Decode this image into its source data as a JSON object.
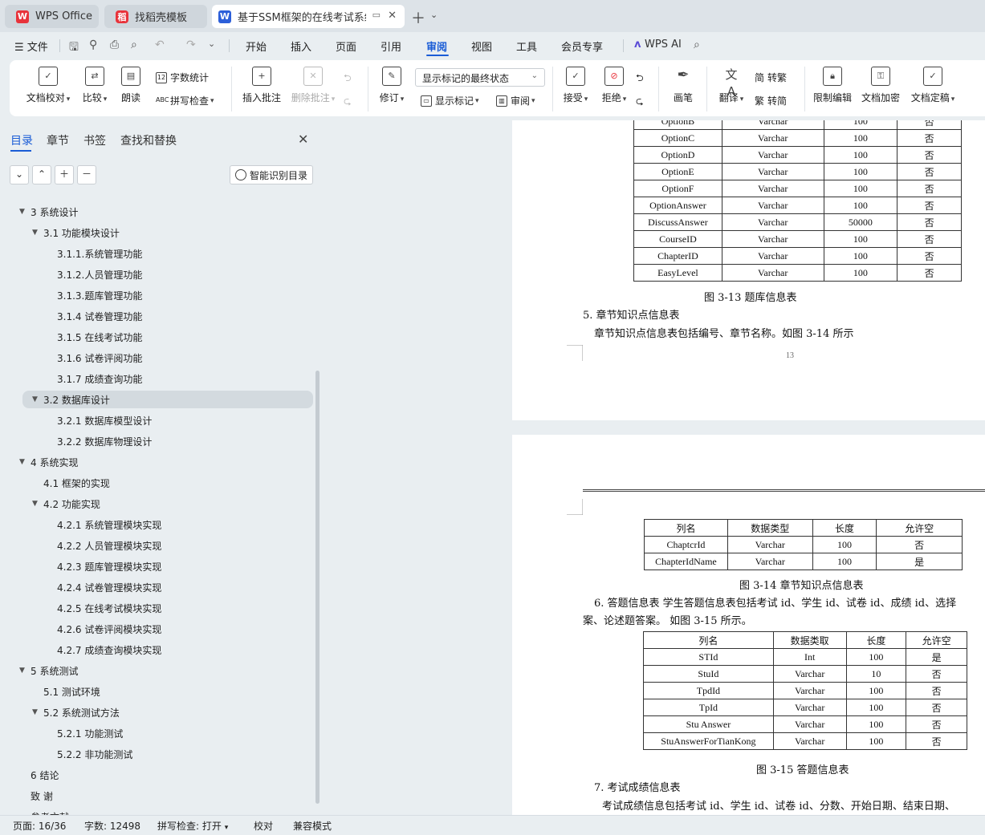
{
  "tabs": [
    {
      "label": "WPS Office",
      "logo": "W"
    },
    {
      "label": "找稻壳模板",
      "logo": "稻"
    },
    {
      "label": "基于SSM框架的在线考试系统",
      "logo": "W"
    }
  ],
  "menu": {
    "file": "文件",
    "items": [
      "开始",
      "插入",
      "页面",
      "引用",
      "审阅",
      "视图",
      "工具",
      "会员专享"
    ],
    "active": "审阅",
    "wps_ai": "WPS AI"
  },
  "ribbon": {
    "doc_check": "文档校对",
    "compare": "比较",
    "read_aloud": "朗读",
    "word_count": "字数统计",
    "spell_check": "拼写检查",
    "insert_comment": "插入批注",
    "delete_comment": "删除批注",
    "revise": "修订",
    "markup_state": "显示标记的最终状态",
    "show_markup": "显示标记",
    "review": "审阅",
    "accept": "接受",
    "reject": "拒绝",
    "pen": "画笔",
    "translate": "翻译",
    "to_traditional": "转繁",
    "to_simplified": "转简",
    "restrict_edit": "限制编辑",
    "doc_encrypt": "文档加密",
    "doc_finalize": "文档定稿"
  },
  "nav": {
    "tabs": [
      "目录",
      "章节",
      "书签",
      "查找和替换"
    ],
    "smart_toc": "智能识别目录",
    "items": [
      {
        "label": "3  系统设计",
        "level": 1,
        "toggle": "▼"
      },
      {
        "label": "3.1  功能模块设计",
        "level": 2,
        "toggle": "▼"
      },
      {
        "label": "3.1.1.系统管理功能",
        "level": 3,
        "toggle": ""
      },
      {
        "label": "3.1.2.人员管理功能",
        "level": 3,
        "toggle": ""
      },
      {
        "label": "3.1.3.题库管理功能",
        "level": 3,
        "toggle": ""
      },
      {
        "label": "3.1.4 试卷管理功能",
        "level": 3,
        "toggle": ""
      },
      {
        "label": "3.1.5 在线考试功能",
        "level": 3,
        "toggle": ""
      },
      {
        "label": "3.1.6 试卷评阅功能",
        "level": 3,
        "toggle": ""
      },
      {
        "label": "3.1.7 成绩查询功能",
        "level": 3,
        "toggle": ""
      },
      {
        "label": "3.2  数据库设计",
        "level": 2,
        "toggle": "▼",
        "selected": true
      },
      {
        "label": "3.2.1  数据库模型设计",
        "level": 3,
        "toggle": ""
      },
      {
        "label": "3.2.2  数据库物理设计",
        "level": 3,
        "toggle": ""
      },
      {
        "label": "4  系统实现",
        "level": 1,
        "toggle": "▼"
      },
      {
        "label": "4.1  框架的实现",
        "level": 2,
        "toggle": ""
      },
      {
        "label": "4.2  功能实现",
        "level": 2,
        "toggle": "▼"
      },
      {
        "label": "4.2.1 系统管理模块实现",
        "level": 3,
        "toggle": ""
      },
      {
        "label": "4.2.2 人员管理模块实现",
        "level": 3,
        "toggle": ""
      },
      {
        "label": "4.2.3 题库管理模块实现",
        "level": 3,
        "toggle": ""
      },
      {
        "label": "4.2.4 试卷管理模块实现",
        "level": 3,
        "toggle": ""
      },
      {
        "label": "4.2.5 在线考试模块实现",
        "level": 3,
        "toggle": ""
      },
      {
        "label": "4.2.6 试卷评阅模块实现",
        "level": 3,
        "toggle": ""
      },
      {
        "label": "4.2.7 成绩查询模块实现",
        "level": 3,
        "toggle": ""
      },
      {
        "label": "5  系统测试",
        "level": 1,
        "toggle": "▼"
      },
      {
        "label": "5.1  测试环境",
        "level": 2,
        "toggle": ""
      },
      {
        "label": "5.2  系统测试方法",
        "level": 2,
        "toggle": "▼"
      },
      {
        "label": "5.2.1 功能测试",
        "level": 3,
        "toggle": ""
      },
      {
        "label": "5.2.2 非功能测试",
        "level": 3,
        "toggle": ""
      },
      {
        "label": "6  结论",
        "level": 1,
        "toggle": ""
      },
      {
        "label": "致     谢",
        "level": 1,
        "toggle": ""
      },
      {
        "label": "参考文献",
        "level": 1,
        "toggle": ""
      }
    ]
  },
  "doc": {
    "table13_rows": [
      [
        "OptionB",
        "Varchar",
        "100",
        "否"
      ],
      [
        "OptionC",
        "Varchar",
        "100",
        "否"
      ],
      [
        "OptionD",
        "Varchar",
        "100",
        "否"
      ],
      [
        "OptionE",
        "Varchar",
        "100",
        "否"
      ],
      [
        "OptionF",
        "Varchar",
        "100",
        "否"
      ],
      [
        "OptionAnswer",
        "Varchar",
        "100",
        "否"
      ],
      [
        "DiscussAnswer",
        "Varchar",
        "50000",
        "否"
      ],
      [
        "CourseID",
        "Varchar",
        "100",
        "否"
      ],
      [
        "ChapterID",
        "Varchar",
        "100",
        "否"
      ],
      [
        "EasyLevel",
        "Varchar",
        "100",
        "否"
      ]
    ],
    "caption13": "图 3-13  题库信息表",
    "heading5": "5.  章节知识点信息表",
    "para5": "章节知识点信息表包括编号、章节名称。如图 3-14  所示",
    "page_number": "13",
    "table14_header": [
      "列名",
      "数据类型",
      "长度",
      "允许空"
    ],
    "table14_rows": [
      [
        "ChaptcrId",
        "Varchar",
        "100",
        "否"
      ],
      [
        "ChapterIdName",
        "Varchar",
        "100",
        "是"
      ]
    ],
    "caption14": "图 3-14 章节知识点信息表",
    "para6_line1": "6.  答题信息表  学生答题信息表包括考试 id、学生 id、试卷 id、成绩 id、选择",
    "para6_line2": "案、论述题答案。  如图 3-15 所示。",
    "table15_header": [
      "列名",
      "数据类取",
      "长度",
      "允许空"
    ],
    "table15_rows": [
      [
        "STId",
        "Int",
        "100",
        "是"
      ],
      [
        "StuId",
        "Varchar",
        "10",
        "否"
      ],
      [
        "TpdId",
        "Varchar",
        "100",
        "否"
      ],
      [
        "TpId",
        "Varchar",
        "100",
        "否"
      ],
      [
        "Stu Answer",
        "Varchar",
        "100",
        "否"
      ],
      [
        "StuAnswerForTianKong",
        "Varchar",
        "100",
        "否"
      ]
    ],
    "caption15": "图 3-15 答题信息表",
    "heading7": "7.  考试成绩信息表",
    "para7": "考试成绩信息包括考试 id、学生 id、试卷 id、分数、开始日期、结束日期、"
  },
  "status": {
    "page": "页面: 16/36",
    "words": "字数: 12498",
    "spell": "拼写检查: 打开",
    "proof": "校对",
    "compat": "兼容模式"
  },
  "colors": {
    "accent": "#1a5cd6",
    "wps_red": "#e8333b"
  }
}
